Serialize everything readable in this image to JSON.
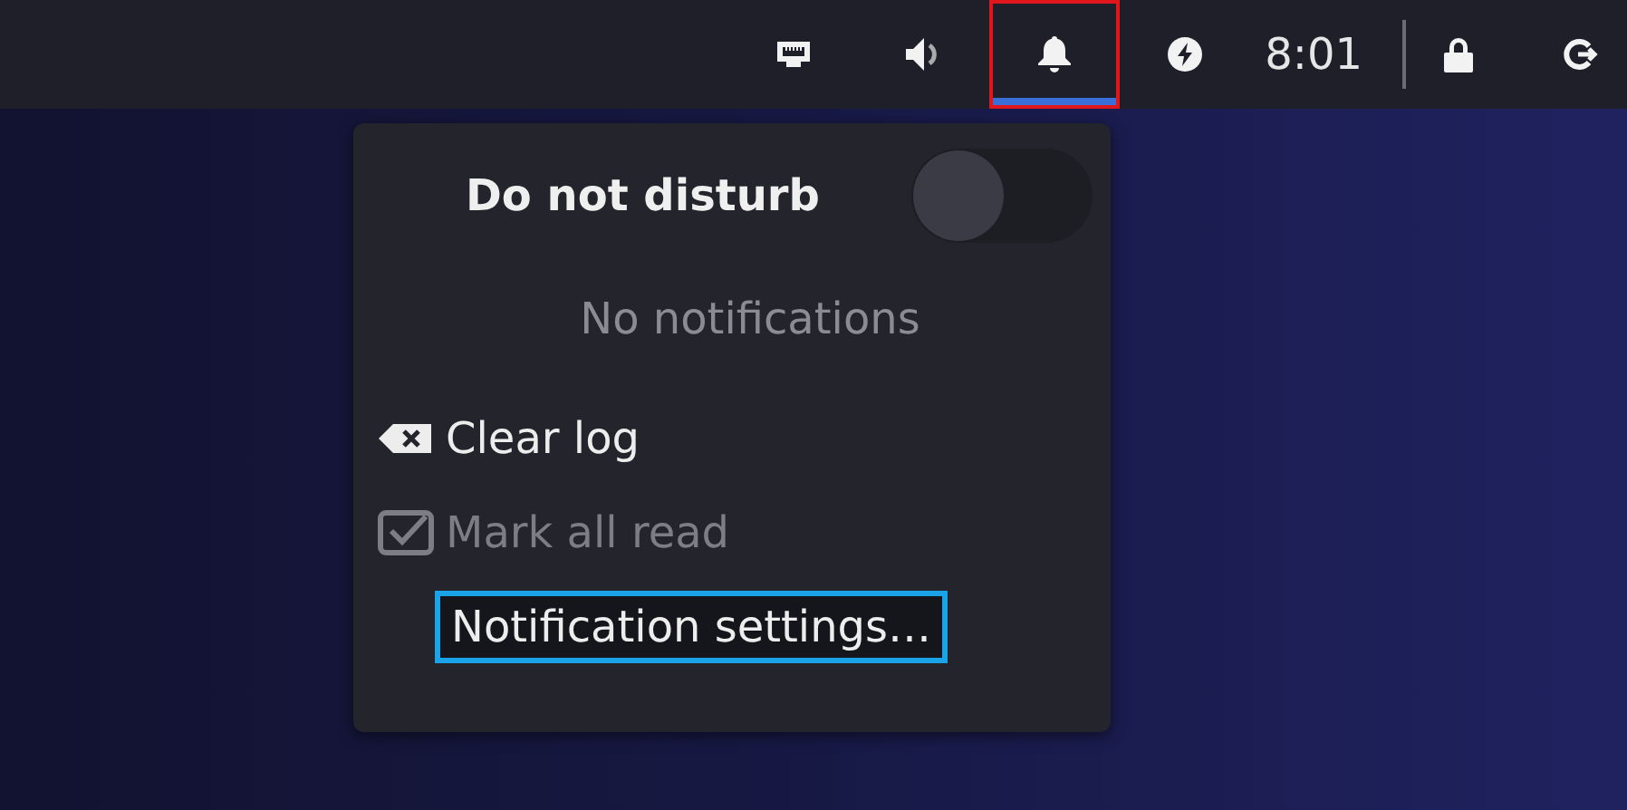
{
  "top_bar": {
    "indicators": [
      {
        "kind": "network",
        "selected": false
      },
      {
        "kind": "volume",
        "selected": false
      },
      {
        "kind": "bell",
        "selected": true
      },
      {
        "kind": "power",
        "selected": false
      }
    ],
    "clock": "8:01",
    "right_icons": [
      {
        "kind": "lock"
      },
      {
        "kind": "logout"
      }
    ]
  },
  "notification_menu": {
    "do_not_disturb": {
      "label": "Do not disturb",
      "on": false
    },
    "empty_text": "No notifications",
    "actions": [
      {
        "kind": "clear",
        "label": "Clear log",
        "disabled": false,
        "focused": false
      },
      {
        "kind": "mark",
        "label": "Mark all read",
        "disabled": true,
        "focused": false
      },
      {
        "kind": "plain",
        "label": "Notification settings…",
        "disabled": false,
        "focused": true
      }
    ]
  }
}
